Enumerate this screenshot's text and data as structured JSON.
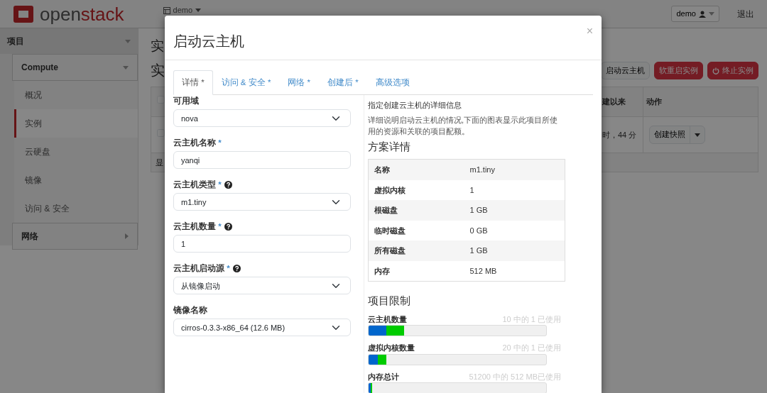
{
  "topbar": {
    "logo_parts": [
      "open",
      "stack"
    ],
    "project_menu": "demo",
    "user_menu": "demo",
    "logout": "退出"
  },
  "sidebar": {
    "header": "项目",
    "section": "Compute",
    "items": [
      {
        "label": "概况",
        "selected": false
      },
      {
        "label": "实例",
        "selected": true
      },
      {
        "label": "云硬盘",
        "selected": false
      },
      {
        "label": "镜像",
        "selected": false
      },
      {
        "label": "访问 & 安全",
        "selected": false
      }
    ],
    "footer_section": "网络"
  },
  "page": {
    "title": "实",
    "subtitle": "实",
    "actions": [
      {
        "label": "启动云主机",
        "kind": "default"
      },
      {
        "label": "软重启实例",
        "kind": "danger"
      },
      {
        "label": "终止实例",
        "kind": "danger"
      }
    ],
    "table": {
      "select_all_checked": false,
      "columns": [
        "建以来",
        "动作"
      ],
      "rows": [
        {
          "age": "时，44 分",
          "action": "创建快照",
          "checked": false
        }
      ],
      "footer": "显"
    }
  },
  "modal": {
    "title": "启动云主机",
    "close": "×",
    "tabs": [
      {
        "label": "详情 *",
        "selected": true
      },
      {
        "label": "访问 & 安全 *",
        "selected": false
      },
      {
        "label": "网络 *",
        "selected": false
      },
      {
        "label": "创建后 *",
        "selected": false
      },
      {
        "label": "高级选项",
        "selected": false
      }
    ],
    "fields": [
      {
        "label": "可用域",
        "kind": "select",
        "value": "nova"
      },
      {
        "label": "云主机名称",
        "mark": "*",
        "kind": "input",
        "value": "yanqi"
      },
      {
        "label": "云主机类型",
        "mark": "*",
        "help": true,
        "kind": "select",
        "value": "m1.tiny"
      },
      {
        "label": "云主机数量",
        "mark": "*",
        "help": true,
        "kind": "input",
        "value": "1"
      },
      {
        "label": "云主机启动源 ",
        "mark": "*",
        "help": true,
        "kind": "select",
        "value": "从镜像启动"
      },
      {
        "label": "镜像名称",
        "kind": "select",
        "value": "cirros-0.3.3-x86_64 (12.6 MB)"
      }
    ],
    "intro": "指定创建云主机的详细信息",
    "description": "详细说明启动云主机的情况,下面的图表显示此项目所使用的资源和关联的项目配额。",
    "flavor_heading": "方案详情",
    "flavor": [
      {
        "name": "名称",
        "value": "m1.tiny"
      },
      {
        "name": "虚拟内核",
        "value": "1"
      },
      {
        "name": "根磁盘",
        "value": "1 GB"
      },
      {
        "name": "临时磁盘",
        "value": "0 GB"
      },
      {
        "name": "所有磁盘",
        "value": "1 GB"
      },
      {
        "name": "内存",
        "value": "512 MB"
      }
    ],
    "limits_heading": "项目限制",
    "limits": [
      {
        "label": "云主机数量",
        "usage": "10 中的 1 已使用",
        "segments": [
          {
            "level": 0.1,
            "color": "#0066cc"
          },
          {
            "level": 0.1,
            "color": "#00cc00"
          }
        ]
      },
      {
        "label": "虚拟内核数量",
        "usage": "20 中的 1 已使用",
        "segments": [
          {
            "level": 0.05,
            "color": "#0066cc"
          },
          {
            "level": 0.05,
            "color": "#00cc00"
          }
        ]
      },
      {
        "label": "内存总计",
        "usage": "51200 中的 512 MB已使用",
        "segments": [
          {
            "level": 0.01,
            "color": "#0066cc"
          },
          {
            "level": 0.01,
            "color": "#00cc00"
          }
        ]
      }
    ]
  }
}
